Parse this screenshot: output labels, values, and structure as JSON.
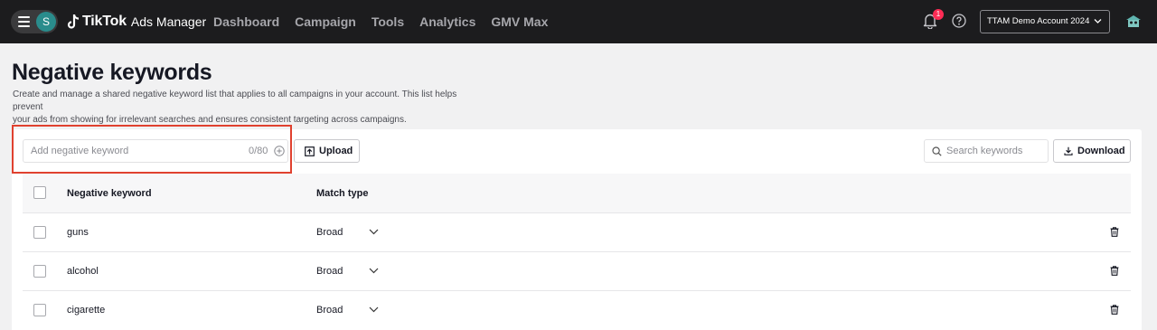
{
  "topbar": {
    "avatar_letter": "S",
    "logo_brand": "TikTok",
    "logo_product": "Ads Manager",
    "nav": [
      "Dashboard",
      "Campaign",
      "Tools",
      "Analytics",
      "GMV Max"
    ],
    "notification_count": "1",
    "account": "TTAM Demo Account 2024"
  },
  "page": {
    "title": "Negative keywords",
    "description_line1": "Create and manage a shared negative keyword list that applies to all campaigns in your account. This list helps prevent",
    "description_line2": "your ads from showing for irrelevant searches and ensures consistent targeting across campaigns."
  },
  "toolbar": {
    "keyword_placeholder": "Add negative keyword",
    "keyword_count": "0/80",
    "upload_label": "Upload",
    "search_placeholder": "Search keywords",
    "download_label": "Download"
  },
  "table": {
    "columns": [
      "Negative keyword",
      "Match type"
    ],
    "rows": [
      {
        "keyword": "guns",
        "match": "Broad"
      },
      {
        "keyword": "alcohol",
        "match": "Broad"
      },
      {
        "keyword": "cigarette",
        "match": "Broad"
      }
    ]
  },
  "colors": {
    "topbar": "#1c1c1e",
    "highlight": "#e0412f",
    "badge": "#fe2c55",
    "avatar": "#2a8c8c"
  }
}
